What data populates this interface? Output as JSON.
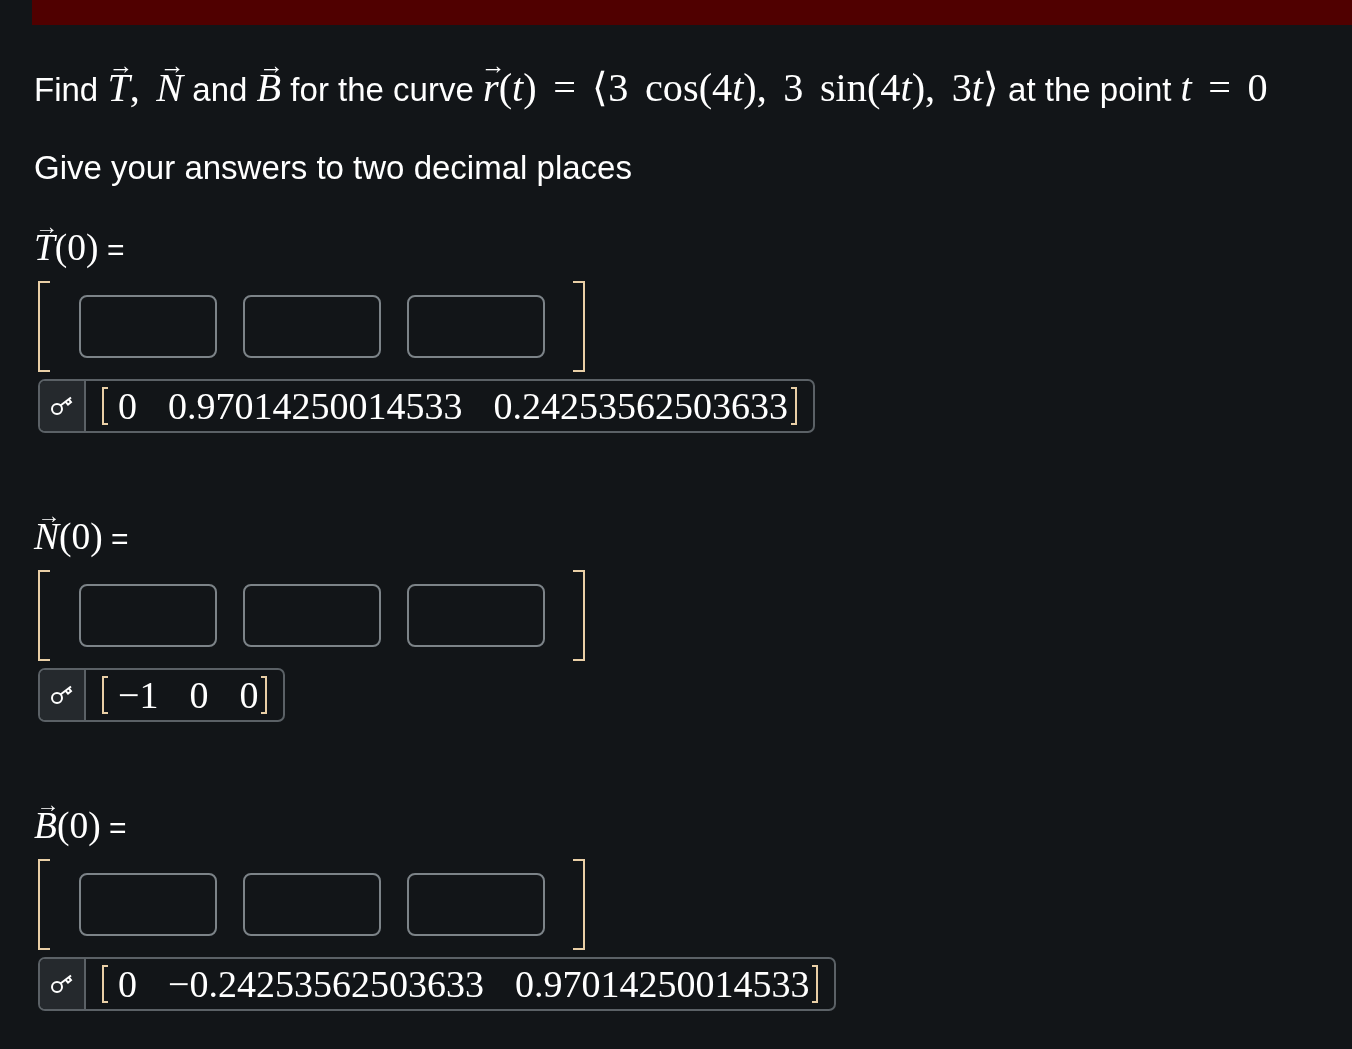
{
  "question": {
    "parts": [
      {
        "kind": "text",
        "text": "Find "
      },
      {
        "kind": "vector",
        "accent": "→",
        "text": "T"
      },
      {
        "kind": "math",
        "text": ", "
      },
      {
        "kind": "vector",
        "accent": "→",
        "text": "N"
      },
      {
        "kind": "text",
        "text": " and "
      },
      {
        "kind": "vector",
        "accent": "→",
        "text": "B"
      },
      {
        "kind": "text",
        "text": " for the curve "
      },
      {
        "kind": "vector",
        "accent": "→",
        "text": "r"
      },
      {
        "kind": "math",
        "text": "("
      },
      {
        "kind": "var",
        "text": "t"
      },
      {
        "kind": "math",
        "text": ") = ⟨3 cos(4"
      },
      {
        "kind": "var",
        "text": "t"
      },
      {
        "kind": "math",
        "text": "), 3 sin(4"
      },
      {
        "kind": "var",
        "text": "t"
      },
      {
        "kind": "math",
        "text": "), 3"
      },
      {
        "kind": "var",
        "text": "t"
      },
      {
        "kind": "math",
        "text": "⟩"
      },
      {
        "kind": "text",
        "text": " at the point "
      },
      {
        "kind": "var",
        "text": "t"
      },
      {
        "kind": "math",
        "text": " = 0"
      }
    ]
  },
  "instruction": "Give your answers to two decimal places",
  "answers": [
    {
      "label": {
        "parts": [
          {
            "kind": "vector",
            "accent": "→",
            "text": "T"
          },
          {
            "kind": "math",
            "text": "(0)"
          },
          {
            "kind": "text",
            "text": " ="
          }
        ]
      },
      "answer": [
        "0",
        "0.97014250014533",
        "0.24253562503633"
      ]
    },
    {
      "label": {
        "parts": [
          {
            "kind": "vector",
            "accent": "→",
            "text": "N"
          },
          {
            "kind": "math",
            "text": "(0)"
          },
          {
            "kind": "text",
            "text": " ="
          }
        ]
      },
      "answer": [
        "−1",
        "0",
        "0"
      ]
    },
    {
      "label": {
        "parts": [
          {
            "kind": "vector",
            "accent": "→",
            "text": "B"
          },
          {
            "kind": "math",
            "text": "(0)"
          },
          {
            "kind": "text",
            "text": " ="
          }
        ]
      },
      "answer": [
        "0",
        "−0.24253562503633",
        "0.97014250014533"
      ]
    }
  ]
}
